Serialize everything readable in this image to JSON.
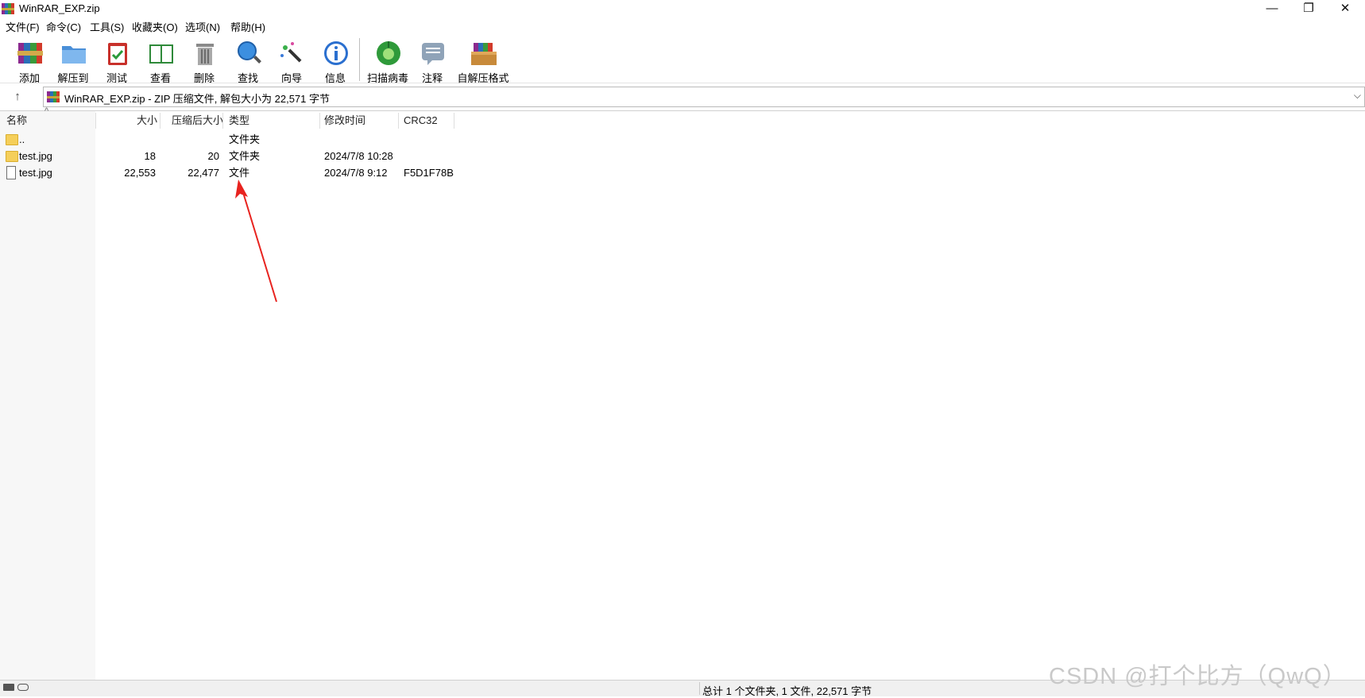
{
  "window": {
    "title": "WinRAR_EXP.zip",
    "minimize_glyph": "—",
    "maximize_glyph": "❐",
    "close_glyph": "✕"
  },
  "menu": [
    "文件(F)",
    "命令(C)",
    "工具(S)",
    "收藏夹(O)",
    "选项(N)",
    "帮助(H)"
  ],
  "toolbar": [
    {
      "label": "添加",
      "icon": "add-archive-icon"
    },
    {
      "label": "解压到",
      "icon": "extract-folder-icon"
    },
    {
      "label": "测试",
      "icon": "test-clipboard-icon"
    },
    {
      "label": "查看",
      "icon": "view-book-icon"
    },
    {
      "label": "删除",
      "icon": "delete-trash-icon"
    },
    {
      "label": "查找",
      "icon": "find-magnifier-icon"
    },
    {
      "label": "向导",
      "icon": "wizard-wand-icon"
    },
    {
      "label": "信息",
      "icon": "info-icon"
    },
    {
      "label": "扫描病毒",
      "icon": "virus-scan-icon"
    },
    {
      "label": "注释",
      "icon": "comment-icon"
    },
    {
      "label": "自解压格式",
      "icon": "sfx-box-icon"
    }
  ],
  "address": {
    "up_glyph": "↑",
    "path": "WinRAR_EXP.zip - ZIP 压缩文件, 解包大小为 22,571 字节",
    "dropdown_glyph": "⌵"
  },
  "columns": {
    "name": "名称",
    "size": "大小",
    "packed": "压缩后大小",
    "type": "类型",
    "modified": "修改时间",
    "crc": "CRC32",
    "sort_glyph": "^"
  },
  "files": [
    {
      "name": "..",
      "size": "",
      "packed": "",
      "type": "文件夹",
      "modified": "",
      "crc": "",
      "kind": "folder"
    },
    {
      "name": "test.jpg",
      "size": "18",
      "packed": "20",
      "type": "文件夹",
      "modified": "2024/7/8 10:28",
      "crc": "",
      "kind": "folder"
    },
    {
      "name": "test.jpg",
      "size": "22,553",
      "packed": "22,477",
      "type": "文件",
      "modified": "2024/7/8 9:12",
      "crc": "F5D1F78B",
      "kind": "file"
    }
  ],
  "status": {
    "summary": "总计 1 个文件夹, 1 文件, 22,571 字节"
  },
  "watermark": "CSDN @打个比方（QwQ）",
  "colors": {
    "annotation_arrow": "#e8231f",
    "folder": "#f5cf5a"
  }
}
